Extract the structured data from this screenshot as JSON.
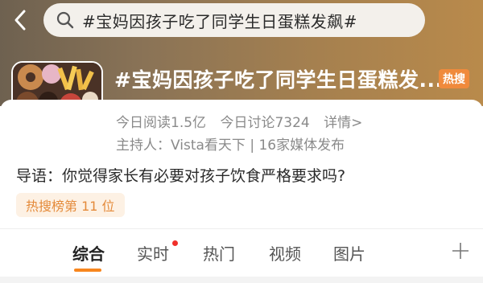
{
  "search": {
    "query": "#宝妈因孩子吃了同学生日蛋糕发飙#"
  },
  "topic": {
    "title": "#宝妈因孩子吃了同学生日蛋糕发...",
    "badge": "热搜",
    "stats": {
      "reads": "今日阅读1.5亿",
      "discussions": "今日讨论7324",
      "details": "详情>"
    },
    "host": "主持人：Vista看天下 | 16家媒体发布",
    "lead": "导语：你觉得家长有必要对孩子饮食严格要求吗?",
    "rank": "热搜榜第 11 位"
  },
  "tabs": [
    {
      "label": "综合",
      "active": true
    },
    {
      "label": "实时",
      "active": false,
      "has_dot": true
    },
    {
      "label": "热门",
      "active": false
    },
    {
      "label": "视频",
      "active": false
    },
    {
      "label": "图片",
      "active": false
    }
  ],
  "colors": {
    "accent": "#f7861e",
    "badge": "#f08a3c",
    "rank_text": "#e48a3a",
    "dot": "#f0302a"
  },
  "icons": {
    "back": "chevron-left-icon",
    "search": "search-icon",
    "add": "plus-icon"
  }
}
